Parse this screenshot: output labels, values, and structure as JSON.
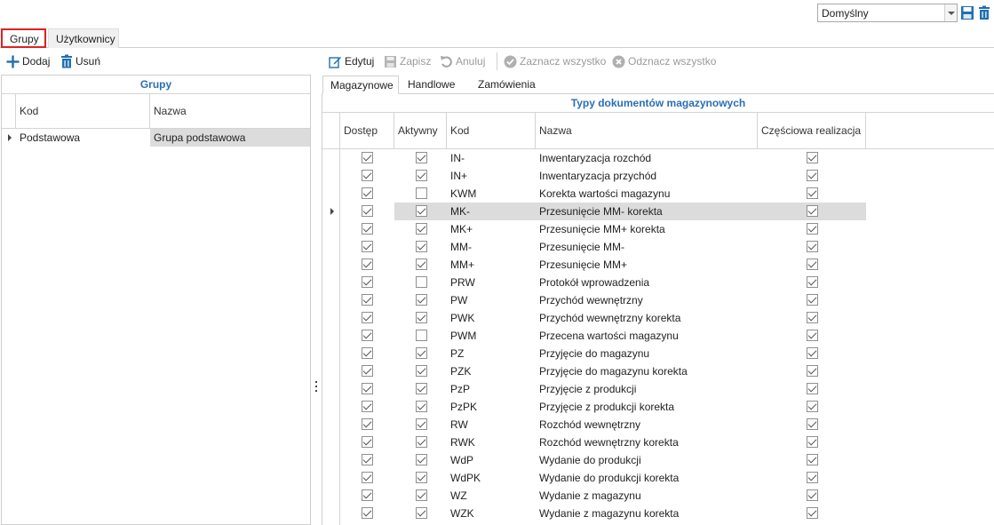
{
  "topbar": {
    "layout_value": "Domyślny"
  },
  "main_tabs": [
    "Grupy",
    "Użytkownicy"
  ],
  "left_toolbar": {
    "add": "Dodaj",
    "delete": "Usuń"
  },
  "left_grid": {
    "caption": "Grupy",
    "columns": [
      "Kod",
      "Nazwa"
    ],
    "rows": [
      {
        "kod": "Podstawowa",
        "nazwa": "Grupa podstawowa"
      }
    ]
  },
  "right_toolbar": {
    "edit": "Edytuj",
    "save": "Zapisz",
    "cancel": "Anuluj",
    "select_all": "Zaznacz wszystko",
    "deselect_all": "Odznacz wszystko"
  },
  "right_tabs": [
    "Magazynowe",
    "Handlowe",
    "Zamówienia"
  ],
  "right_grid": {
    "caption": "Typy dokumentów magazynowych",
    "columns": [
      "Dostęp",
      "Aktywny",
      "Kod",
      "Nazwa",
      "Częściowa realizacja"
    ],
    "selected_row": 3,
    "rows": [
      {
        "dostep": true,
        "aktywny": true,
        "kod": "IN-",
        "nazwa": "Inwentaryzacja rozchód",
        "czesciowa": true
      },
      {
        "dostep": true,
        "aktywny": true,
        "kod": "IN+",
        "nazwa": "Inwentaryzacja przychód",
        "czesciowa": true
      },
      {
        "dostep": true,
        "aktywny": false,
        "kod": "KWM",
        "nazwa": "Korekta wartości magazynu",
        "czesciowa": true
      },
      {
        "dostep": true,
        "aktywny": true,
        "kod": "MK-",
        "nazwa": "Przesunięcie MM- korekta",
        "czesciowa": true
      },
      {
        "dostep": true,
        "aktywny": true,
        "kod": "MK+",
        "nazwa": "Przesunięcie MM+ korekta",
        "czesciowa": true
      },
      {
        "dostep": true,
        "aktywny": true,
        "kod": "MM-",
        "nazwa": "Przesunięcie MM-",
        "czesciowa": true
      },
      {
        "dostep": true,
        "aktywny": true,
        "kod": "MM+",
        "nazwa": "Przesunięcie MM+",
        "czesciowa": true
      },
      {
        "dostep": true,
        "aktywny": false,
        "kod": "PRW",
        "nazwa": "Protokół wprowadzenia",
        "czesciowa": true
      },
      {
        "dostep": true,
        "aktywny": true,
        "kod": "PW",
        "nazwa": "Przychód wewnętrzny",
        "czesciowa": true
      },
      {
        "dostep": true,
        "aktywny": true,
        "kod": "PWK",
        "nazwa": "Przychód wewnętrzny korekta",
        "czesciowa": true
      },
      {
        "dostep": true,
        "aktywny": false,
        "kod": "PWM",
        "nazwa": "Przecena wartości magazynu",
        "czesciowa": true
      },
      {
        "dostep": true,
        "aktywny": true,
        "kod": "PZ",
        "nazwa": "Przyjęcie do magazynu",
        "czesciowa": true
      },
      {
        "dostep": true,
        "aktywny": true,
        "kod": "PZK",
        "nazwa": "Przyjęcie do magazynu korekta",
        "czesciowa": true
      },
      {
        "dostep": true,
        "aktywny": true,
        "kod": "PzP",
        "nazwa": "Przyjęcie z produkcji",
        "czesciowa": true
      },
      {
        "dostep": true,
        "aktywny": true,
        "kod": "PzPK",
        "nazwa": "Przyjęcie z produkcji korekta",
        "czesciowa": true
      },
      {
        "dostep": true,
        "aktywny": true,
        "kod": "RW",
        "nazwa": "Rozchód wewnętrzny",
        "czesciowa": true
      },
      {
        "dostep": true,
        "aktywny": true,
        "kod": "RWK",
        "nazwa": "Rozchód wewnętrzny korekta",
        "czesciowa": true
      },
      {
        "dostep": true,
        "aktywny": true,
        "kod": "WdP",
        "nazwa": "Wydanie do produkcji",
        "czesciowa": true
      },
      {
        "dostep": true,
        "aktywny": true,
        "kod": "WdPK",
        "nazwa": "Wydanie do produkcji korekta",
        "czesciowa": true
      },
      {
        "dostep": true,
        "aktywny": true,
        "kod": "WZ",
        "nazwa": "Wydanie z magazynu",
        "czesciowa": true
      },
      {
        "dostep": true,
        "aktywny": true,
        "kod": "WZK",
        "nazwa": "Wydanie z magazynu korekta",
        "czesciowa": true
      }
    ]
  },
  "colors": {
    "accent": "#2a6fb5",
    "selected_row": "#dcdcdc",
    "active_tab_border": "#e02020"
  },
  "icons": [
    "plus-icon",
    "trash-icon",
    "edit-icon",
    "save-icon",
    "undo-icon",
    "check-circle-icon",
    "x-circle-icon",
    "chevron-down-icon",
    "row-indicator-icon"
  ]
}
